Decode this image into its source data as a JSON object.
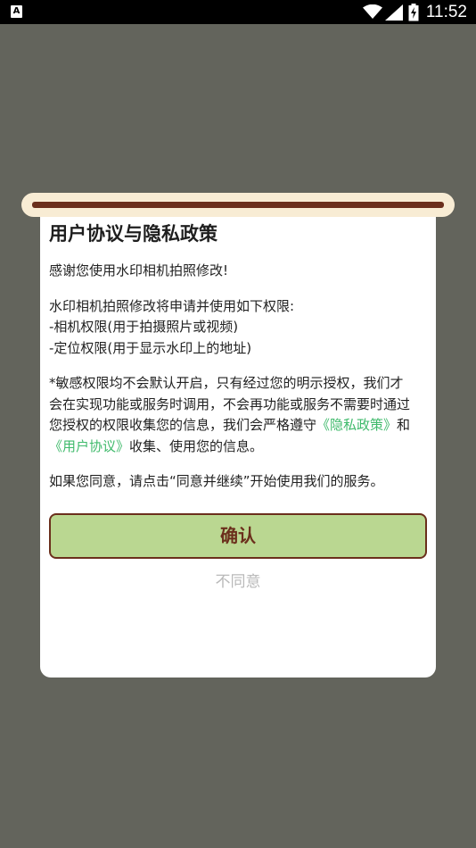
{
  "status_bar": {
    "left_icon": "A",
    "time": "11:52",
    "icons": [
      "wifi-icon",
      "signal-icon",
      "battery-charging-icon"
    ]
  },
  "dialog": {
    "title": "用户协议与隐私政策",
    "greeting": "感谢您使用水印相机拍照修改!",
    "permissions_intro": "水印相机拍照修改将申请并使用如下权限:",
    "permission_camera": "-相机权限(用于拍摄照片或视频)",
    "permission_location": "-定位权限(用于显示水印上的地址)",
    "notice_line1": "*敏感权限均不会默认开启，只有经过您的明示授权，我们才",
    "notice_line2": "会在实现功能或服务时调用，不会再功能或服务不需要时通过",
    "notice_line3_pre": "您授权的权限收集您的信息，我们会严格遵守",
    "privacy_link": "《隐私政策》",
    "notice_and": "和",
    "agreement_link": "《用户协议》",
    "notice_line4_post": "收集、使用您的信息。",
    "agree_hint": "如果您同意，请点击“同意并继续”开始使用我们的服务。",
    "confirm_label": "确认",
    "decline_label": "不同意"
  },
  "colors": {
    "backdrop": "#63645c",
    "accent_brown": "#6b2f1c",
    "button_green": "#bad791",
    "link_green": "#3fba6b",
    "scroll_cream": "#f8ecd4"
  }
}
